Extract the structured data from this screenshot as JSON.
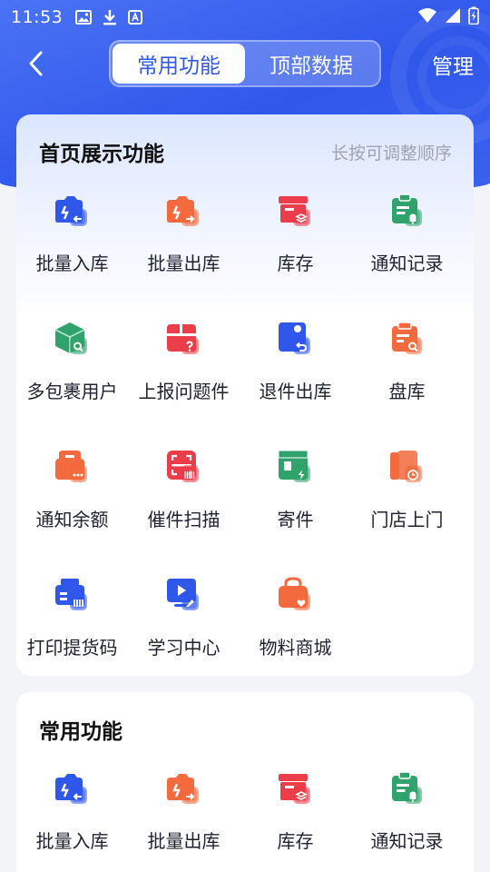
{
  "status_bar": {
    "time": "11:53"
  },
  "nav": {
    "tabs": [
      {
        "label": "常用功能",
        "active": true
      },
      {
        "label": "顶部数据",
        "active": false
      }
    ],
    "manage_label": "管理"
  },
  "home_section": {
    "title": "首页展示功能",
    "hint": "长按可调整顺序",
    "items": [
      {
        "label": "批量入库",
        "icon": "batch-in-icon",
        "color": "#2f57ea"
      },
      {
        "label": "批量出库",
        "icon": "batch-out-icon",
        "color": "#f26a3d"
      },
      {
        "label": "库存",
        "icon": "inventory-icon",
        "color": "#ec3d4a"
      },
      {
        "label": "通知记录",
        "icon": "notice-record-icon",
        "color": "#2fa36b"
      },
      {
        "label": "多包裹用户",
        "icon": "multi-package-icon",
        "color": "#2fa36b"
      },
      {
        "label": "上报问题件",
        "icon": "report-problem-icon",
        "color": "#ec3d4a"
      },
      {
        "label": "退件出库",
        "icon": "return-out-icon",
        "color": "#2f57ea"
      },
      {
        "label": "盘库",
        "icon": "stocktake-icon",
        "color": "#f26a3d"
      },
      {
        "label": "通知余额",
        "icon": "notice-balance-icon",
        "color": "#f26a3d"
      },
      {
        "label": "催件扫描",
        "icon": "urge-scan-icon",
        "color": "#ec3d4a"
      },
      {
        "label": "寄件",
        "icon": "send-package-icon",
        "color": "#2fa36b"
      },
      {
        "label": "门店上门",
        "icon": "store-visit-icon",
        "color": "#f26a3d"
      },
      {
        "label": "打印提货码",
        "icon": "print-code-icon",
        "color": "#2f57ea"
      },
      {
        "label": "学习中心",
        "icon": "learning-center-icon",
        "color": "#2f57ea"
      },
      {
        "label": "物料商城",
        "icon": "material-mall-icon",
        "color": "#f26a3d"
      }
    ]
  },
  "common_section": {
    "title": "常用功能",
    "items": [
      {
        "label": "批量入库",
        "icon": "batch-in-icon",
        "color": "#2f57ea"
      },
      {
        "label": "批量出库",
        "icon": "batch-out-icon",
        "color": "#f26a3d"
      },
      {
        "label": "库存",
        "icon": "inventory-icon",
        "color": "#ec3d4a"
      },
      {
        "label": "通知记录",
        "icon": "notice-record-icon",
        "color": "#2fa36b"
      }
    ]
  }
}
